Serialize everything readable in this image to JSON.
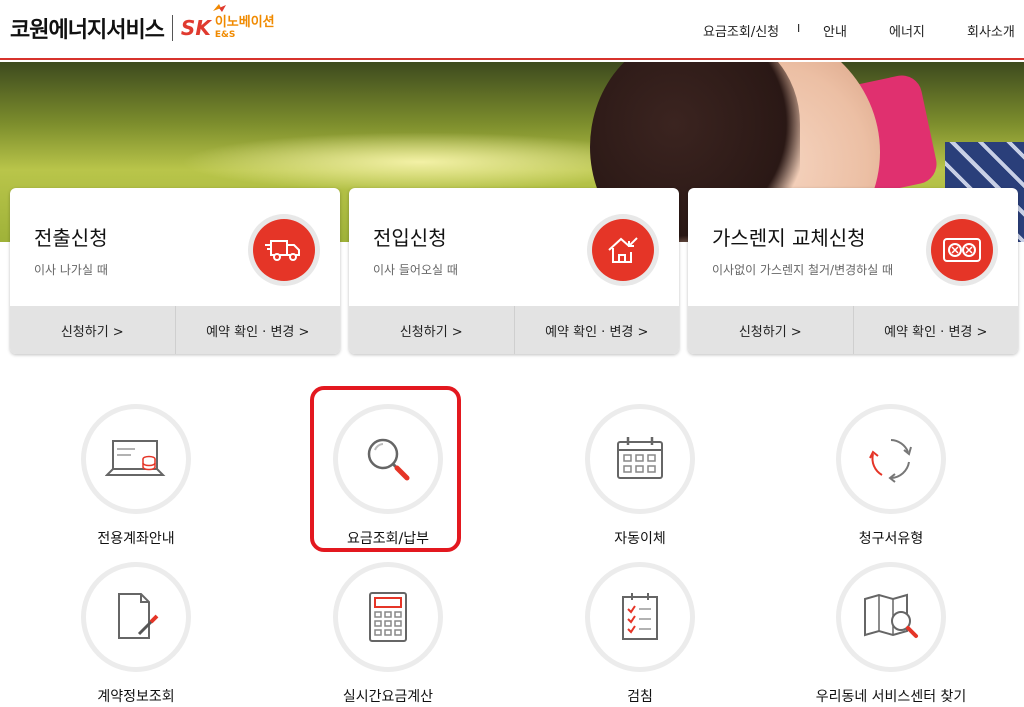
{
  "header": {
    "logo_text": "코원에너지서비스",
    "sk_text": "SK",
    "sk_sub1": "이노베이션",
    "sk_sub2": "E&S",
    "nav": [
      "요금조회/신청",
      "안내",
      "에너지",
      "회사소개"
    ],
    "nav_sep": "I"
  },
  "cards": [
    {
      "title": "전출신청",
      "desc": "이사 나가실 때",
      "apply": "신청하기 >",
      "confirm": "예약 확인 · 변경 >",
      "icon": "moving-truck-icon"
    },
    {
      "title": "전입신청",
      "desc": "이사 들어오실 때",
      "apply": "신청하기 >",
      "confirm": "예약 확인 · 변경 >",
      "icon": "house-arrow-icon"
    },
    {
      "title": "가스렌지 교체신청",
      "desc": "이사없이 가스렌지 철거/변경하실 때",
      "apply": "신청하기 >",
      "confirm": "예약 확인 · 변경 >",
      "icon": "gas-range-icon"
    }
  ],
  "services": [
    {
      "label": "전용계좌안내",
      "icon": "laptop-coins-icon"
    },
    {
      "label": "요금조회/납부",
      "icon": "magnifier-icon"
    },
    {
      "label": "자동이체",
      "icon": "calendar-icon"
    },
    {
      "label": "청구서유형",
      "icon": "cycle-arrows-icon"
    },
    {
      "label": "계약정보조회",
      "icon": "document-pen-icon"
    },
    {
      "label": "실시간요금계산",
      "icon": "calculator-icon"
    },
    {
      "label": "검침",
      "icon": "checklist-icon"
    },
    {
      "label": "우리동네 서비스센터 찾기",
      "icon": "map-magnifier-icon"
    }
  ],
  "colors": {
    "accent": "#e53527",
    "highlight": "#e3181f",
    "brand_orange": "#f08a00"
  }
}
